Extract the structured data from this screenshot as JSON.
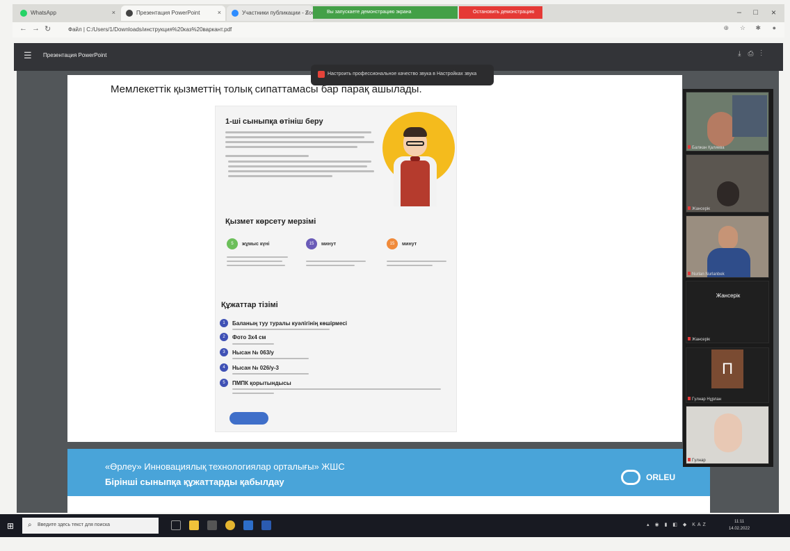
{
  "browser": {
    "tabs": [
      {
        "label": "WhatsApp",
        "color": "#25d366"
      },
      {
        "label": "Презентация PowerPoint",
        "color": "#444444"
      },
      {
        "label": "Участники публикации - Zoom",
        "color": "#2d8cff"
      }
    ],
    "notices": [
      {
        "label": "Вы запускаете демонстрацию экрана",
        "color": "#43a047"
      },
      {
        "label": "Остановить демонстрацию",
        "color": "#e53935"
      }
    ],
    "url": "Файл | C:/Users/1/Downloads/инструкция%20каз%20варкант.pdf",
    "window_controls": {
      "minimize": "–",
      "maximize": "□",
      "close": "×"
    }
  },
  "viewer": {
    "title": "Презентация PowerPoint",
    "toolbar_icons": [
      "download-icon",
      "print-icon",
      "more-icon"
    ]
  },
  "notification": {
    "text": "Настроить профессиональное качество звука в Настройках звука"
  },
  "page1": {
    "heading": "Мемлекеттік қызметтің толық сипаттамасы бар парақ ашылады.",
    "card": {
      "apply_title": "1-ші сыныпқа өтініш беру",
      "term_title": "Қызмет көрсету мерзімі",
      "terms": [
        {
          "num": "5",
          "label": "жұмыс күні",
          "color": "#6cbf5a"
        },
        {
          "num": "15",
          "label": "минут",
          "color": "#6a5bb8"
        },
        {
          "num": "15",
          "label": "минут",
          "color": "#f08a3a"
        }
      ],
      "docs_title": "Құжаттар тізімі",
      "docs": [
        {
          "num": "1",
          "name": "Баланың туу туралы куәлігінің көшірмесі"
        },
        {
          "num": "2",
          "name": "Фото 3х4 см"
        },
        {
          "num": "3",
          "name": "Нысан № 063/у"
        },
        {
          "num": "4",
          "name": "Нысан № 026/у-3"
        },
        {
          "num": "5",
          "name": "ПМПК қорытындысы"
        }
      ]
    }
  },
  "page2": {
    "org": "«Өрлеу» Инновациялық технологиялар орталығы» ЖШС",
    "subtitle": "Бірінші сыныпқа құжаттарды қабылдау",
    "logo": "ORLEU"
  },
  "zoom": {
    "participants": [
      {
        "name": "Балжан Қалиева"
      },
      {
        "name": "Жансерік"
      },
      {
        "name": "Nurlan Nurlanbek"
      },
      {
        "name": "Жансерік"
      },
      {
        "name": "Гүлнар Нұрлан"
      },
      {
        "name": "Гүлнар"
      }
    ],
    "avatar_letter": "П"
  },
  "taskbar": {
    "search_placeholder": "Введите здесь текст для поиска",
    "lang": "KAZ",
    "time": "11:11",
    "date": "14.02.2022"
  }
}
